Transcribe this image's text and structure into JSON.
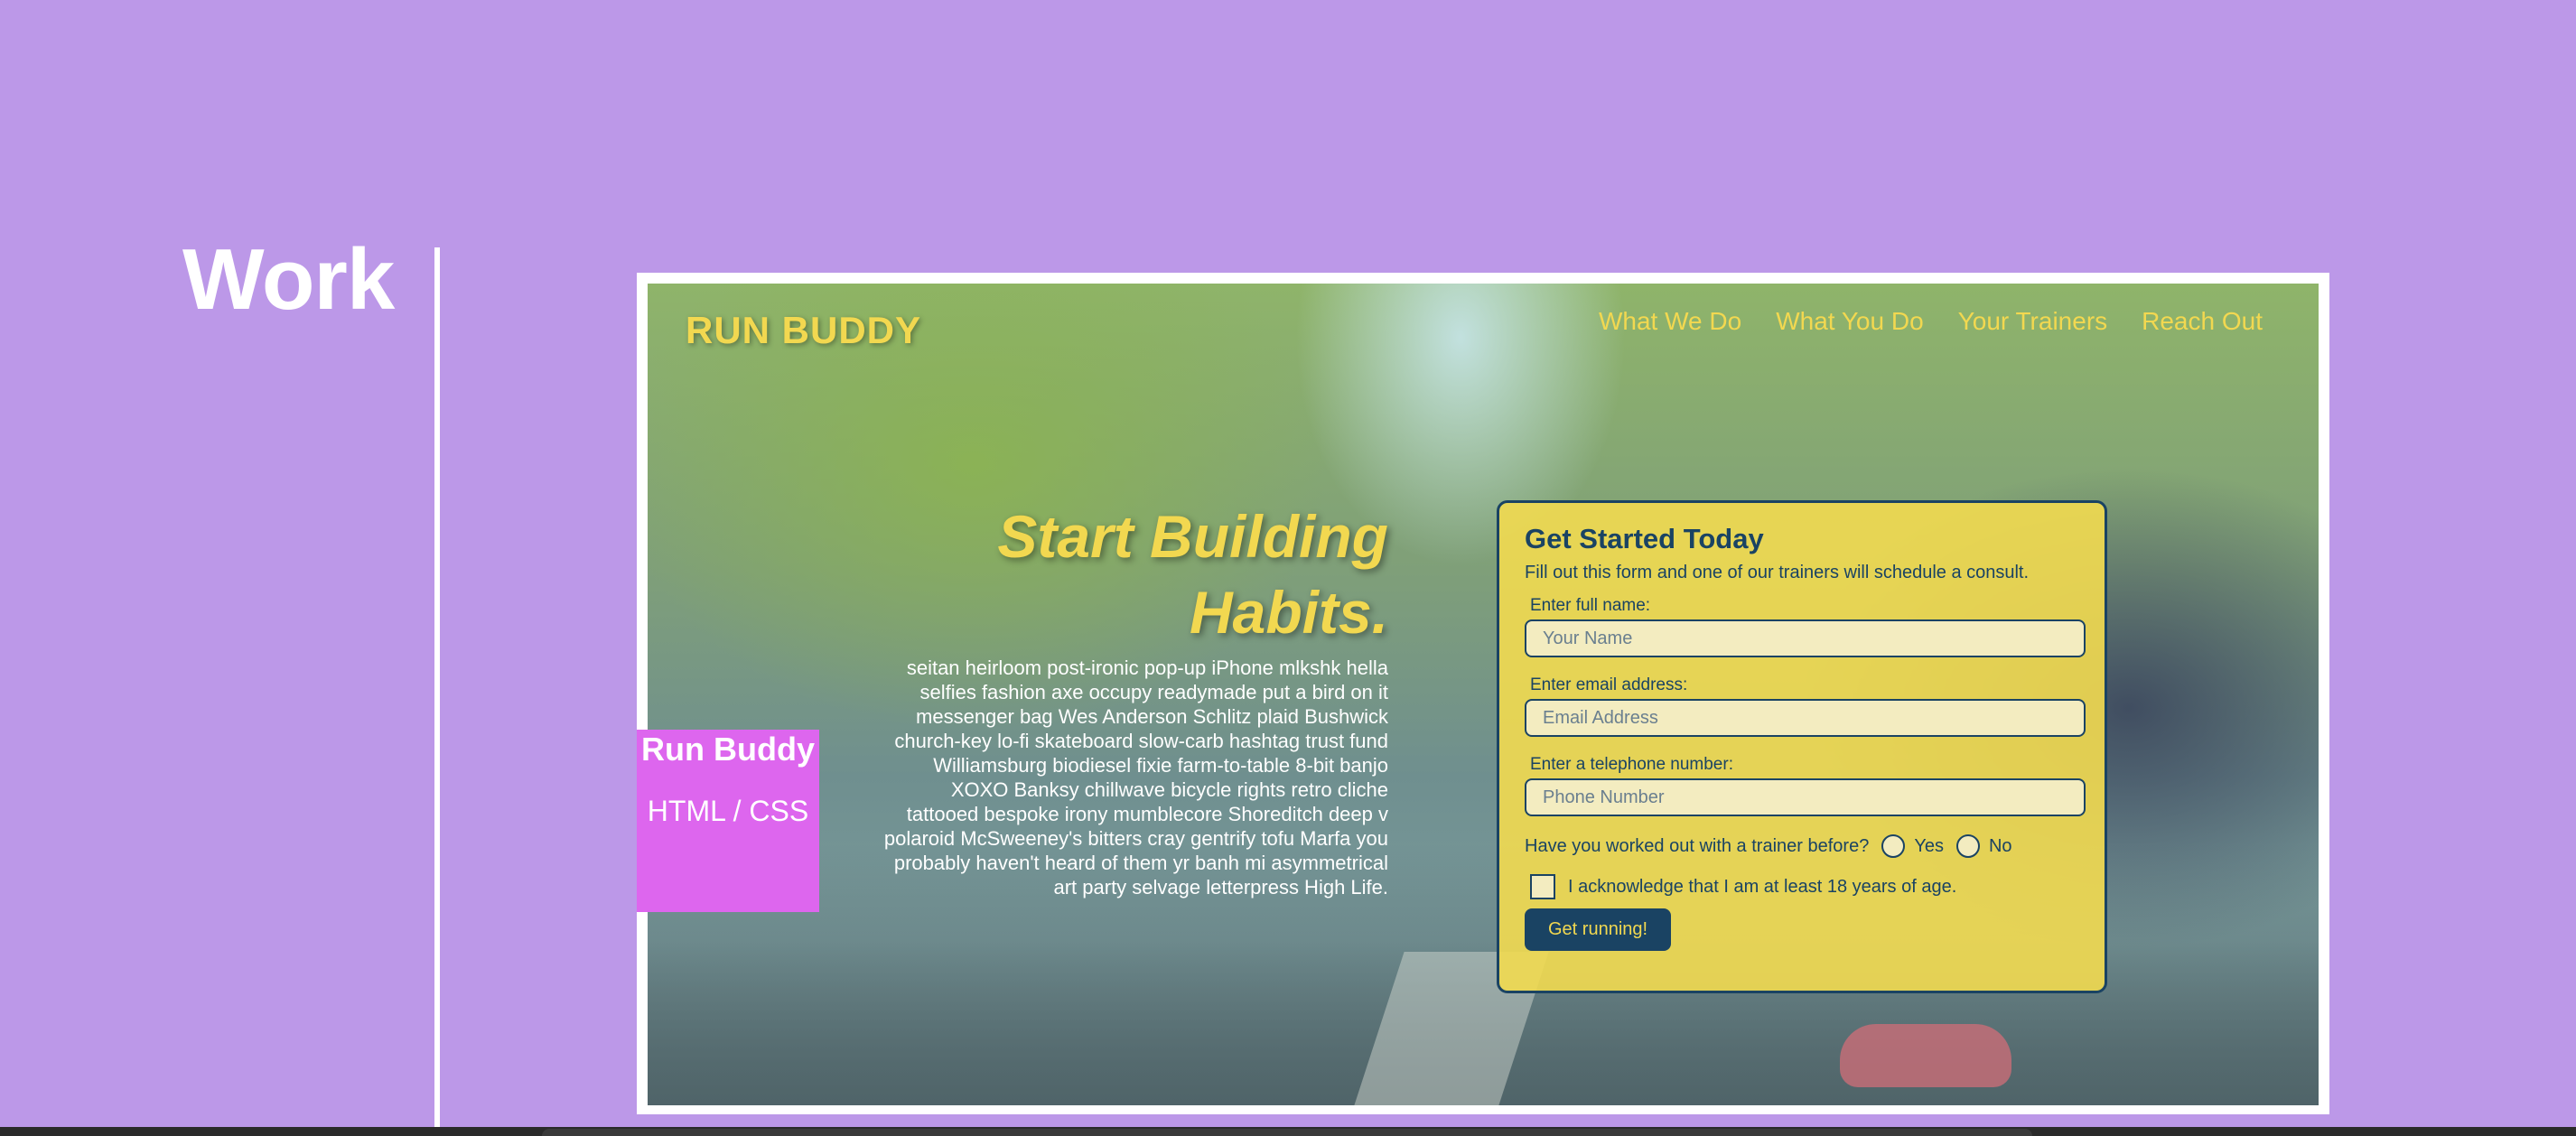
{
  "page": {
    "section_title": "Work"
  },
  "project": {
    "name": "Run Buddy",
    "tech": "HTML / CSS"
  },
  "screenshot": {
    "logo": "RUN BUDDY",
    "nav": [
      "What We Do",
      "What You Do",
      "Your Trainers",
      "Reach Out"
    ],
    "hero": {
      "heading_line1": "Start Building",
      "heading_line2": "Habits.",
      "body_lines": [
        "seitan heirloom post-ironic pop-up iPhone mlkshk hella",
        "selfies fashion axe occupy readymade put a bird on it",
        "messenger bag Wes Anderson Schlitz plaid Bushwick",
        "church-key lo-fi skateboard slow-carb hashtag trust fund",
        "Williamsburg biodiesel fixie farm-to-table 8-bit banjo",
        "XOXO Banksy chillwave bicycle rights retro cliche",
        "tattooed bespoke irony mumblecore Shoreditch deep v",
        "polaroid McSweeney's bitters cray gentrify tofu Marfa you",
        "probably haven't heard of them yr banh mi asymmetrical",
        "art party selvage letterpress High Life."
      ]
    },
    "form": {
      "title": "Get Started Today",
      "subtitle": "Fill out this form and one of our trainers will schedule a consult.",
      "name_label": "Enter full name:",
      "name_placeholder": "Your Name",
      "email_label": "Enter email address:",
      "email_placeholder": "Email Address",
      "phone_label": "Enter a telephone number:",
      "phone_placeholder": "Phone Number",
      "trainer_question": "Have you worked out with a trainer before?",
      "yes_label": "Yes",
      "no_label": "No",
      "age_ack": "I acknowledge that I am at least 18 years of age.",
      "submit_label": "Get running!"
    }
  },
  "colors": {
    "background": "#bc98e8",
    "accent_yellow": "#f2d850",
    "navy": "#1a4363",
    "label_pink": "#dd66ee"
  }
}
